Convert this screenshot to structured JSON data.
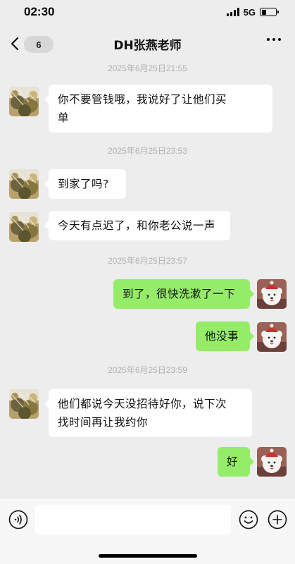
{
  "status_bar": {
    "time": "02:30",
    "network": "5G",
    "battery_percent": 35
  },
  "nav": {
    "unread_count": "6",
    "title": "DH张燕老师",
    "back_icon": "chevron-left-icon",
    "more_icon": "more-horizontal-icon"
  },
  "messages": [
    {
      "type": "timestamp",
      "text": "2025年6月25日21:55"
    },
    {
      "type": "incoming",
      "lines": [
        "你不要管钱哦，我说好了让他们买",
        "单"
      ]
    },
    {
      "type": "timestamp",
      "text": "2025年6月25日23:53"
    },
    {
      "type": "incoming",
      "lines": [
        "到家了吗?"
      ]
    },
    {
      "type": "incoming",
      "lines": [
        "今天有点迟了，和你老公说一声"
      ]
    },
    {
      "type": "timestamp",
      "text": "2025年6月25日23:57"
    },
    {
      "type": "outgoing",
      "lines": [
        "到了，很快洗漱了一下"
      ]
    },
    {
      "type": "outgoing",
      "lines": [
        "他没事"
      ]
    },
    {
      "type": "timestamp",
      "text": "2025年6月25日23:59"
    },
    {
      "type": "incoming",
      "lines": [
        "他们都说今天没招待好你，说下次",
        "找时间再让我约你"
      ]
    },
    {
      "type": "outgoing",
      "lines": [
        "好"
      ]
    }
  ],
  "input_bar": {
    "voice_icon": "voice-icon",
    "emoji_icon": "emoji-icon",
    "plus_icon": "plus-circle-icon",
    "text_value": ""
  },
  "colors": {
    "background": "#ededed",
    "outgoing_bubble": "#95ec69",
    "incoming_bubble": "#ffffff",
    "timestamp": "#b1b1b1"
  }
}
